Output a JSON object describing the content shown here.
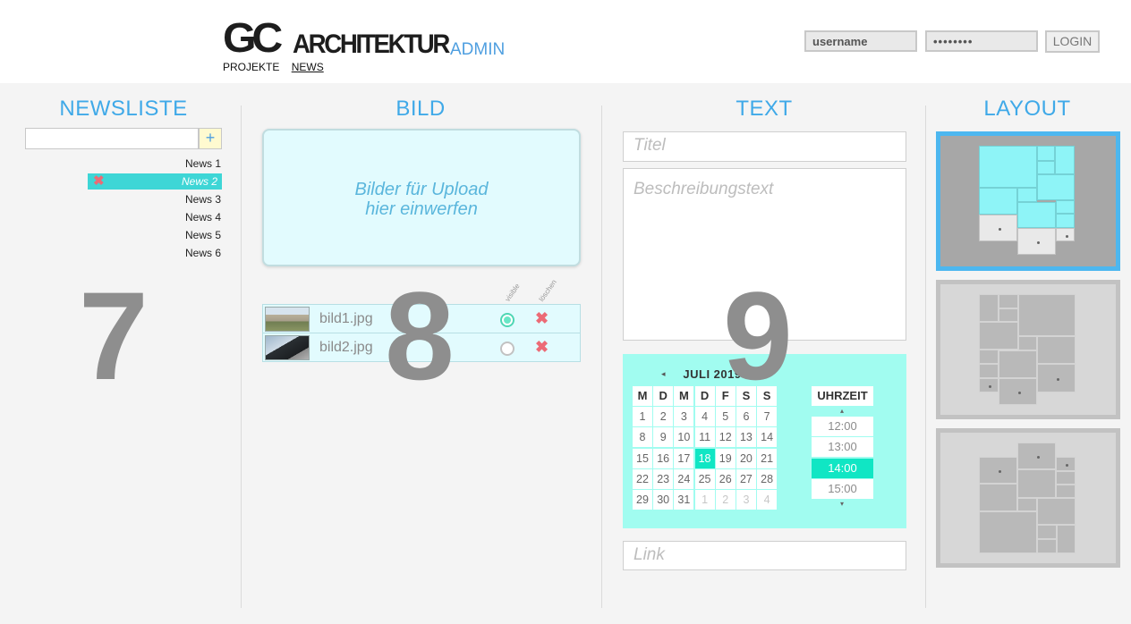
{
  "header": {
    "logo_gc": "GC",
    "logo_arch": "ARCHITEKTUR",
    "logo_admin": "ADMIN",
    "nav": [
      {
        "label": "PROJEKTE",
        "active": false
      },
      {
        "label": "NEWS",
        "active": true
      }
    ],
    "username_value": "username",
    "password_value": "••••••••",
    "login_label": "LOGIN"
  },
  "columns": {
    "newsliste": "NEWSLISTE",
    "bild": "BILD",
    "text": "TEXT",
    "layout": "LAYOUT"
  },
  "newsliste": {
    "add_label": "+",
    "items": [
      {
        "label": "News 1",
        "selected": false
      },
      {
        "label": "News 2",
        "selected": true
      },
      {
        "label": "News 3",
        "selected": false
      },
      {
        "label": "News 4",
        "selected": false
      },
      {
        "label": "News 5",
        "selected": false
      },
      {
        "label": "News 6",
        "selected": false
      }
    ],
    "delete_glyph": "✖"
  },
  "annotations": {
    "n7": "7",
    "n8": "8",
    "n9": "9"
  },
  "bild": {
    "dropzone_line1": "Bilder für Upload",
    "dropzone_line2": "hier einwerfen",
    "col_visible": "visible",
    "col_delete": "löschen",
    "images": [
      {
        "name": "bild1.jpg",
        "visible": true
      },
      {
        "name": "bild2.jpg",
        "visible": false
      }
    ],
    "delete_glyph": "✖"
  },
  "text": {
    "title_placeholder": "Titel",
    "description_placeholder": "Beschreibungstext",
    "link_placeholder": "Link",
    "calendar": {
      "month": "JULI 2019",
      "prev": "◂",
      "next": "▸",
      "weekdays": [
        "M",
        "D",
        "M",
        "D",
        "F",
        "S",
        "S"
      ],
      "weeks": [
        [
          "1",
          "2",
          "3",
          "4",
          "5",
          "6",
          "7"
        ],
        [
          "8",
          "9",
          "10",
          "11",
          "12",
          "13",
          "14"
        ],
        [
          "15",
          "16",
          "17",
          "18",
          "19",
          "20",
          "21"
        ],
        [
          "22",
          "23",
          "24",
          "25",
          "26",
          "27",
          "28"
        ],
        [
          "29",
          "30",
          "31",
          "1",
          "2",
          "3",
          "4"
        ]
      ],
      "selected_day": "18",
      "uhrzeit_label": "UHRZEIT",
      "up": "▴",
      "down": "▾",
      "times": [
        "12:00",
        "13:00",
        "14:00",
        "15:00"
      ],
      "selected_time": "14:00"
    }
  },
  "colors": {
    "accent_blue": "#3fa9e8",
    "selected_cyan": "#3ed6d6",
    "calendar_bg": "#a1fcf0",
    "highlight": "#10e6c4",
    "delete_red": "#ec6b76"
  }
}
